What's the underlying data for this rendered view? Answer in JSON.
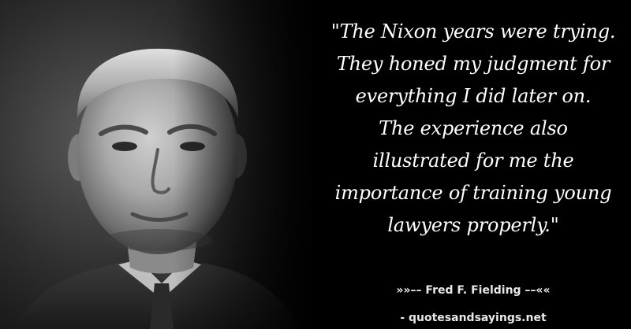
{
  "quote": {
    "text": "\"The Nixon years were trying.\nThey honed my judgment for\neverything I did later on.\nThe experience also\nillustrated for me the\nimportance of training young\nlawyers properly.\""
  },
  "attribution": {
    "author_line": "»»–– Fred F. Fielding ––««"
  },
  "footer": {
    "site": "- quotesandsayings.net"
  },
  "colors": {
    "background": "#000000",
    "text": "#ffffff"
  }
}
